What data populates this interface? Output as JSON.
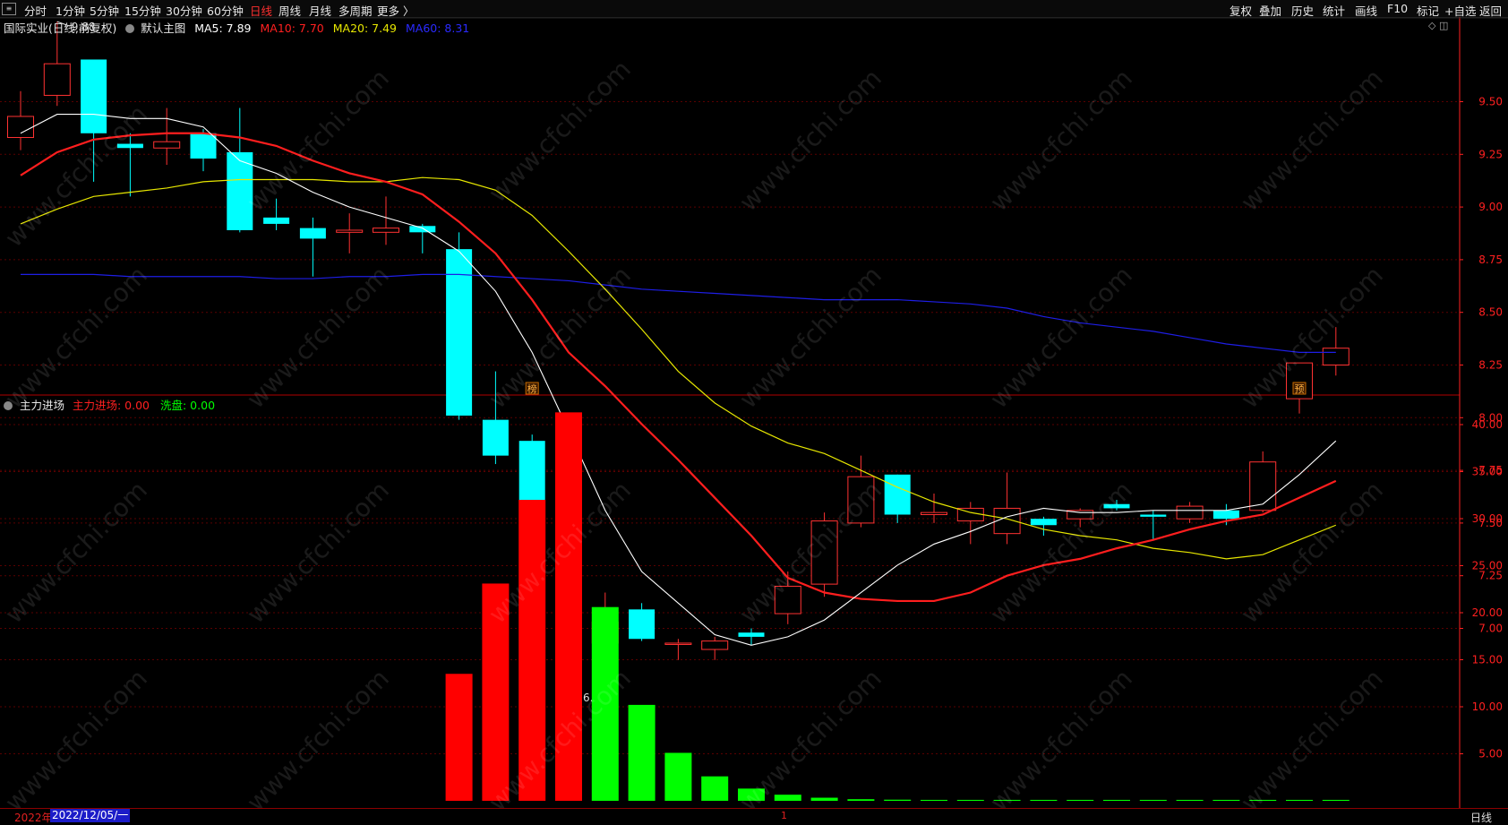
{
  "toolbar": {
    "left": [
      "分时",
      "1分钟",
      "5分钟",
      "15分钟",
      "30分钟",
      "60分钟",
      "日线",
      "周线",
      "月线",
      "多周期",
      "更多 〉"
    ],
    "active": "日线",
    "right": [
      "复权",
      "叠加",
      "历史",
      "统计",
      "画线",
      "F10",
      "标记",
      "+自选",
      "返回"
    ]
  },
  "main_title": {
    "stock": "国际实业(日线,前复权)",
    "template": "默认主图",
    "ma5": "MA5: 7.89",
    "ma10": "MA10: 7.70",
    "ma20": "MA20: 7.49",
    "ma60": "MA60: 8.31"
  },
  "sub_title": {
    "name": "主力进场",
    "main_label": "主力进场: 0.00",
    "wash_label": "洗盘: 0.00"
  },
  "colors": {
    "up": "#ff3232",
    "down": "#00ffff",
    "ma5": "#ffffff",
    "ma10": "#ff1e1e",
    "ma20": "#e6e600",
    "ma60": "#1e1ee6",
    "main_bar": "#ff0000",
    "wash_bar": "#00ff00",
    "axis": "#ff2020"
  },
  "annotations": {
    "high": "9.88",
    "low": "6.67",
    "marker1": "榜",
    "marker2": "预"
  },
  "bottom_bar": {
    "year": "2022年",
    "date": "2022/12/05/一",
    "mid": "1",
    "period": "日线"
  },
  "watermark": "www.cfchi.com",
  "chart_data": [
    {
      "type": "candlestick",
      "y_ticks": [
        "9.50",
        "9.25",
        "9.00",
        "8.75",
        "8.50",
        "8.25",
        "8.00",
        "7.75",
        "7.50",
        "7.25",
        "7.00"
      ],
      "candles": [
        {
          "o": 9.33,
          "h": 9.55,
          "l": 9.27,
          "c": 9.43
        },
        {
          "o": 9.53,
          "h": 9.88,
          "l": 9.48,
          "c": 9.68
        },
        {
          "o": 9.7,
          "h": 9.7,
          "l": 9.12,
          "c": 9.35
        },
        {
          "o": 9.3,
          "h": 9.35,
          "l": 9.05,
          "c": 9.28
        },
        {
          "o": 9.28,
          "h": 9.47,
          "l": 9.2,
          "c": 9.31
        },
        {
          "o": 9.35,
          "h": 9.37,
          "l": 9.17,
          "c": 9.23
        },
        {
          "o": 9.26,
          "h": 9.47,
          "l": 8.88,
          "c": 8.89
        },
        {
          "o": 8.95,
          "h": 9.04,
          "l": 8.89,
          "c": 8.92
        },
        {
          "o": 8.9,
          "h": 8.95,
          "l": 8.67,
          "c": 8.85
        },
        {
          "o": 8.88,
          "h": 8.97,
          "l": 8.78,
          "c": 8.89
        },
        {
          "o": 8.88,
          "h": 9.05,
          "l": 8.82,
          "c": 8.9
        },
        {
          "o": 8.91,
          "h": 8.92,
          "l": 8.78,
          "c": 8.88
        },
        {
          "o": 8.8,
          "h": 8.88,
          "l": 7.99,
          "c": 8.01
        },
        {
          "o": 7.99,
          "h": 8.22,
          "l": 7.78,
          "c": 7.82
        },
        {
          "o": 7.89,
          "h": 7.92,
          "l": 7.05,
          "c": 7.06
        },
        {
          "o": 6.8,
          "h": 7.1,
          "l": 6.67,
          "c": 6.86
        },
        {
          "o": 6.93,
          "h": 7.17,
          "l": 6.92,
          "c": 7.03
        },
        {
          "o": 7.09,
          "h": 7.12,
          "l": 6.94,
          "c": 6.95
        },
        {
          "o": 6.93,
          "h": 6.95,
          "l": 6.85,
          "c": 6.93
        },
        {
          "o": 6.9,
          "h": 6.96,
          "l": 6.85,
          "c": 6.94
        },
        {
          "o": 6.98,
          "h": 7.0,
          "l": 6.92,
          "c": 6.96
        },
        {
          "o": 7.07,
          "h": 7.27,
          "l": 7.02,
          "c": 7.2
        },
        {
          "o": 7.21,
          "h": 7.55,
          "l": 7.15,
          "c": 7.51
        },
        {
          "o": 7.5,
          "h": 7.82,
          "l": 7.48,
          "c": 7.72
        },
        {
          "o": 7.73,
          "h": 7.73,
          "l": 7.5,
          "c": 7.54
        },
        {
          "o": 7.54,
          "h": 7.64,
          "l": 7.5,
          "c": 7.55
        },
        {
          "o": 7.51,
          "h": 7.6,
          "l": 7.4,
          "c": 7.57
        },
        {
          "o": 7.45,
          "h": 7.74,
          "l": 7.4,
          "c": 7.57
        },
        {
          "o": 7.52,
          "h": 7.53,
          "l": 7.44,
          "c": 7.49
        },
        {
          "o": 7.52,
          "h": 7.57,
          "l": 7.48,
          "c": 7.56
        },
        {
          "o": 7.59,
          "h": 7.61,
          "l": 7.56,
          "c": 7.57
        },
        {
          "o": 7.54,
          "h": 7.56,
          "l": 7.42,
          "c": 7.53
        },
        {
          "o": 7.52,
          "h": 7.6,
          "l": 7.5,
          "c": 7.58
        },
        {
          "o": 7.56,
          "h": 7.59,
          "l": 7.49,
          "c": 7.52
        },
        {
          "o": 7.56,
          "h": 7.84,
          "l": 7.55,
          "c": 7.79
        },
        {
          "o": 8.09,
          "h": 8.26,
          "l": 8.02,
          "c": 8.26
        },
        {
          "o": 8.25,
          "h": 8.43,
          "l": 8.2,
          "c": 8.33
        }
      ],
      "ma5": [
        9.35,
        9.44,
        9.44,
        9.42,
        9.42,
        9.38,
        9.22,
        9.16,
        9.07,
        9.0,
        8.95,
        8.9,
        8.79,
        8.6,
        8.31,
        7.94,
        7.56,
        7.27,
        7.12,
        6.97,
        6.92,
        6.96,
        7.04,
        7.17,
        7.3,
        7.4,
        7.46,
        7.53,
        7.57,
        7.55,
        7.55,
        7.56,
        7.56,
        7.56,
        7.59,
        7.73,
        7.89
      ],
      "ma10": [
        9.15,
        9.26,
        9.32,
        9.34,
        9.35,
        9.35,
        9.33,
        9.29,
        9.22,
        9.16,
        9.12,
        9.06,
        8.93,
        8.78,
        8.56,
        8.31,
        8.15,
        7.97,
        7.8,
        7.62,
        7.44,
        7.24,
        7.17,
        7.14,
        7.13,
        7.13,
        7.17,
        7.25,
        7.3,
        7.33,
        7.38,
        7.42,
        7.47,
        7.51,
        7.54,
        7.62,
        7.7
      ],
      "ma20": [
        8.92,
        8.99,
        9.05,
        9.07,
        9.09,
        9.12,
        9.13,
        9.13,
        9.13,
        9.12,
        9.12,
        9.14,
        9.13,
        9.08,
        8.96,
        8.79,
        8.61,
        8.42,
        8.22,
        8.07,
        7.96,
        7.88,
        7.83,
        7.75,
        7.67,
        7.6,
        7.55,
        7.52,
        7.47,
        7.44,
        7.42,
        7.38,
        7.36,
        7.33,
        7.35,
        7.42,
        7.49
      ],
      "ma60": [
        8.68,
        8.68,
        8.68,
        8.67,
        8.67,
        8.67,
        8.67,
        8.66,
        8.66,
        8.67,
        8.67,
        8.68,
        8.68,
        8.67,
        8.66,
        8.65,
        8.63,
        8.61,
        8.6,
        8.59,
        8.58,
        8.57,
        8.56,
        8.56,
        8.56,
        8.55,
        8.54,
        8.52,
        8.48,
        8.45,
        8.43,
        8.41,
        8.38,
        8.35,
        8.33,
        8.31,
        8.31
      ]
    },
    {
      "type": "bar",
      "y_ticks": [
        "40.00",
        "35.00",
        "30.00",
        "25.00",
        "20.00",
        "15.00",
        "10.00",
        "5.00"
      ],
      "series": [
        {
          "name": "主力进场",
          "values": [
            0,
            0,
            0,
            0,
            0,
            0,
            0,
            0,
            0,
            0,
            0,
            0,
            13.5,
            23.1,
            32.0,
            41.3,
            0,
            0,
            0,
            0,
            0,
            0,
            0,
            0,
            0,
            0,
            0,
            0,
            0,
            0,
            0,
            0,
            0,
            0,
            0,
            0,
            0
          ]
        },
        {
          "name": "洗盘",
          "values": [
            0,
            0,
            0,
            0,
            0,
            0,
            0,
            0,
            0,
            0,
            0,
            0,
            0,
            0,
            0,
            0,
            20.6,
            10.2,
            5.1,
            2.6,
            1.3,
            0.65,
            0.33,
            0.17,
            0.12,
            0.1,
            0.1,
            0.1,
            0.1,
            0.1,
            0.1,
            0.1,
            0.1,
            0.1,
            0.1,
            0.1,
            0.1
          ]
        }
      ]
    }
  ]
}
